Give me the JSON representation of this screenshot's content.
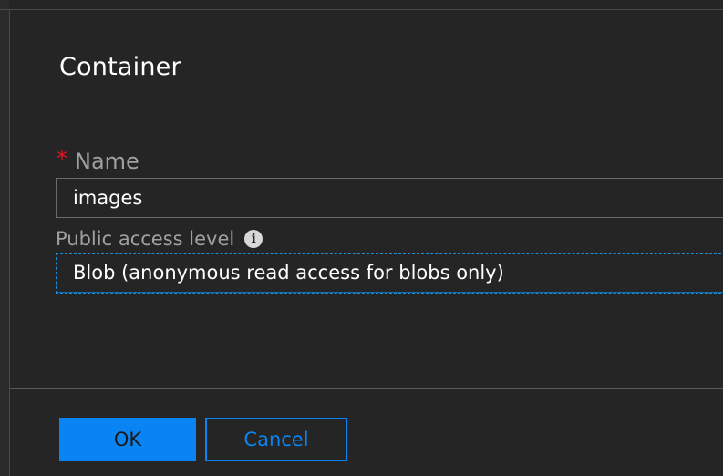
{
  "dialog": {
    "title": "Container"
  },
  "name_field": {
    "required_marker": "*",
    "label": "Name",
    "value": "images"
  },
  "access_field": {
    "label": "Public access level",
    "info_icon": "info-icon",
    "info_glyph": "i",
    "selected_value": "Blob (anonymous read access for blobs only)"
  },
  "buttons": {
    "ok_label": "OK",
    "cancel_label": "Cancel"
  },
  "colors": {
    "background": "#252525",
    "accent": "#0a84f2",
    "required": "#e81123",
    "label": "#a0a0a0"
  }
}
